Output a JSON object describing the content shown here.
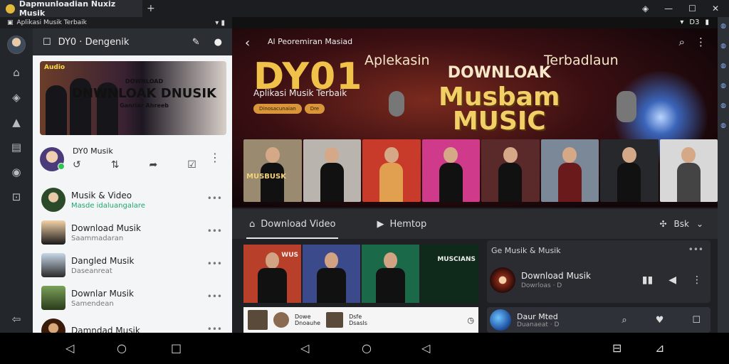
{
  "titlebar": {
    "tab_title": "Dapmunloadian Nuxiz Musik",
    "new_tab": "+",
    "controls": [
      "◈",
      "—",
      "☐",
      "✕"
    ]
  },
  "statusbar_left": {
    "app": "Aplikasi Musik Terbaik",
    "right": "▾ ▮"
  },
  "statusbar_right": {
    "icons": [
      "▾",
      "D3",
      "▮"
    ]
  },
  "sidebar": {
    "icons": [
      "home-icon",
      "explore-icon",
      "library-icon",
      "list-icon",
      "mail-icon",
      "download-icon"
    ],
    "bottom_icon": "logout-icon"
  },
  "panel": {
    "title": "DY0 · Dengenik",
    "banner": {
      "tag": "Audio",
      "small1": "DOWNLOAD",
      "big": "DNWNLOAK DNUSIK",
      "small2": "Ganriar Ahreeb"
    },
    "player": {
      "name": "DY0 Musik"
    },
    "items": [
      {
        "title": "Musik & Video",
        "subtitle": "Masde idaluangalare",
        "green": true
      },
      {
        "title": "Download Musik",
        "subtitle": "Saammadaran",
        "green": false
      },
      {
        "title": "Dangled Musik",
        "subtitle": "Daseanreat",
        "green": false
      },
      {
        "title": "Downlar Musik",
        "subtitle": "Samendean",
        "green": false
      },
      {
        "title": "Damndad Musik",
        "subtitle": "",
        "green": false
      }
    ]
  },
  "hero": {
    "breadcrumb": "Al Peoremiran Masiad",
    "big": "DY01",
    "subtitle": "Aplikasi Musik Terbaik",
    "pill1": "Dinosacunaian",
    "pill2": "Dre",
    "left_word": "Aplekasin",
    "right_word": "Terbadlaun",
    "music_line1": "DOWNLOAK",
    "music_line2": "Musbam",
    "music_line3": "MUSIC",
    "strip_label": "MUSBUSK"
  },
  "tabs": {
    "active": "Download Video",
    "second": "Hemtop",
    "select": "Bsk"
  },
  "grid": {
    "label1": "WUS",
    "label2": "MUSCIANS"
  },
  "minirow": {
    "text1a": "Dowe",
    "text1b": "Dnoauhe",
    "text2a": "Dsfe",
    "text2b": "Dsasls"
  },
  "sidecard": {
    "header": "Ge Musik & Musik",
    "track_title": "Download Musik",
    "track_sub": "Dowrloas · D",
    "row2_title": "Daur Mted",
    "row2_sub": "Duanaeat · D"
  },
  "colors": {
    "accent_gold": "#f0c24a",
    "status_green": "#1fa76a"
  }
}
